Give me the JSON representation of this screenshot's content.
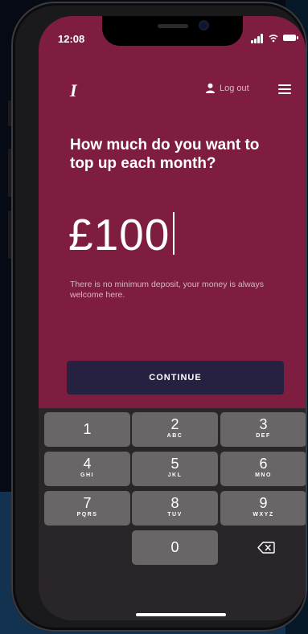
{
  "status_bar": {
    "time": "12:08"
  },
  "header": {
    "logo": "I",
    "logout_label": "Log out",
    "icons": {
      "user": "person-icon",
      "menu": "hamburger-menu-icon"
    }
  },
  "main": {
    "question": "How much do you want to top up each month?",
    "amount": "£100",
    "note": "There is no minimum deposit, your money is always welcome here.",
    "continue_label": "CONTINUE"
  },
  "keypad": {
    "keys": [
      {
        "digit": "1",
        "letters": ""
      },
      {
        "digit": "2",
        "letters": "ABC"
      },
      {
        "digit": "3",
        "letters": "DEF"
      },
      {
        "digit": "4",
        "letters": "GHI"
      },
      {
        "digit": "5",
        "letters": "JKL"
      },
      {
        "digit": "6",
        "letters": "MNO"
      },
      {
        "digit": "7",
        "letters": "PQRS"
      },
      {
        "digit": "8",
        "letters": "TUV"
      },
      {
        "digit": "9",
        "letters": "WXYZ"
      },
      {
        "digit": "0",
        "letters": ""
      }
    ],
    "backspace_icon": "backspace-icon"
  },
  "colors": {
    "screen_background": "#7f1d40",
    "button_background": "#262041",
    "keyboard_background": "#2a2528",
    "key_background": "#6a6567"
  }
}
